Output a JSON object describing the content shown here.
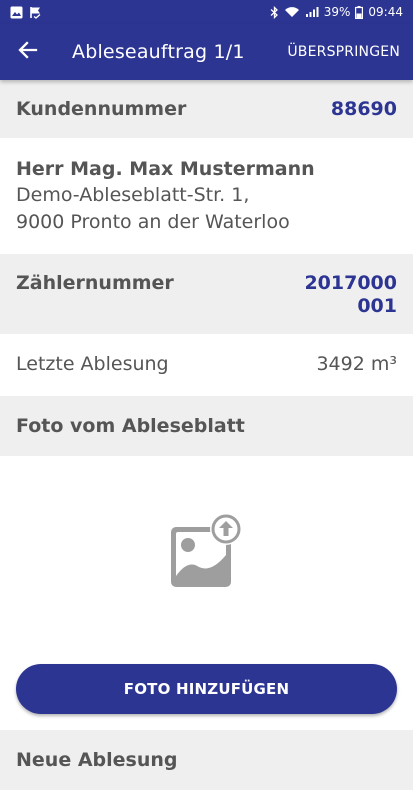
{
  "status_bar": {
    "battery": "39%",
    "time": "09:44",
    "icons": [
      "image-icon",
      "flag-check-icon",
      "bluetooth-icon",
      "wifi-icon",
      "signal-icon",
      "battery-icon"
    ]
  },
  "app_bar": {
    "back_icon": "arrow-back-icon",
    "title": "Ableseauftrag 1/1",
    "skip_label": "ÜBERSPRINGEN"
  },
  "customer": {
    "label": "Kundennummer",
    "number": "88690"
  },
  "address": {
    "name": "Herr Mag. Max Mustermann",
    "street": "Demo-Ableseblatt-Str. 1,",
    "city": "9000 Pronto an der Waterloo"
  },
  "meter": {
    "label": "Zählernummer",
    "number_line1": "2017000",
    "number_line2": "001"
  },
  "last_reading": {
    "label": "Letzte Ablesung",
    "value": "3492 m³"
  },
  "photo": {
    "header": "Foto vom Ableseblatt",
    "placeholder_icon": "image-upload-icon",
    "button_label": "FOTO HINZUFÜGEN"
  },
  "new_reading": {
    "label": "Neue Ablesung"
  },
  "colors": {
    "primary": "#2d3593",
    "section_gray": "#efefef",
    "text": "#555555"
  }
}
